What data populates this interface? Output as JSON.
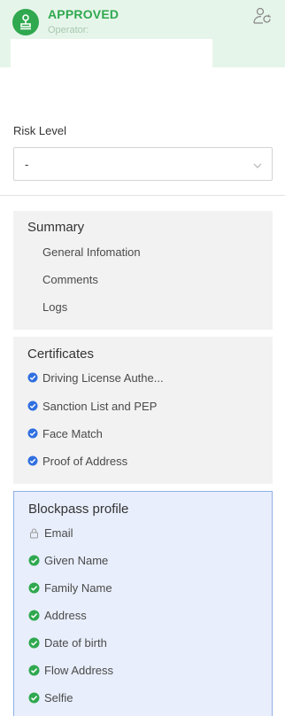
{
  "status": {
    "label": "APPROVED",
    "operator_label": "Operator:",
    "icon": "stamp-icon",
    "assign_icon": "user-sync-icon",
    "color": "#2fa84f",
    "background": "#e6f5ea"
  },
  "risk": {
    "title": "Risk Level",
    "value": "-",
    "icon": "chevron-down-icon"
  },
  "summary": {
    "title": "Summary",
    "items": [
      {
        "label": "General Infomation"
      },
      {
        "label": "Comments"
      },
      {
        "label": "Logs"
      }
    ]
  },
  "certificates": {
    "title": "Certificates",
    "icon": "check-circle-icon",
    "icon_color": "#2f6fe0",
    "items": [
      {
        "label": "Driving License Authe..."
      },
      {
        "label": "Sanction List and PEP"
      },
      {
        "label": "Face Match"
      },
      {
        "label": "Proof of Address"
      }
    ]
  },
  "profile": {
    "title": "Blockpass profile",
    "verified_color": "#2fa84f",
    "items": [
      {
        "label": "Email",
        "icon": "lock-icon"
      },
      {
        "label": "Given Name",
        "icon": "check-circle-icon"
      },
      {
        "label": "Family Name",
        "icon": "check-circle-icon"
      },
      {
        "label": "Address",
        "icon": "check-circle-icon"
      },
      {
        "label": "Date of birth",
        "icon": "check-circle-icon"
      },
      {
        "label": "Flow Address",
        "icon": "check-circle-icon"
      },
      {
        "label": "Selfie",
        "icon": "check-circle-icon"
      }
    ]
  }
}
